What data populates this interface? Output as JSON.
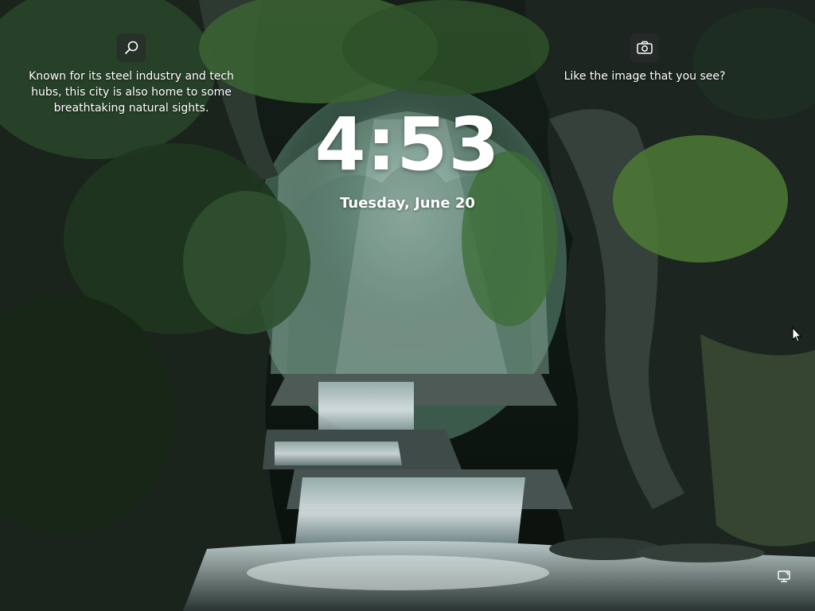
{
  "lockscreen": {
    "spotlight": {
      "info_icon": "search-icon",
      "info_text": "Known for its steel industry and tech hubs, this city is also home to some breathtaking natural sights.",
      "like_icon": "camera-icon",
      "like_text": "Like the image that you see?"
    },
    "clock": {
      "time": "4:53",
      "date": "Tuesday, June 20"
    },
    "status": {
      "network_icon": "network-icon"
    }
  },
  "colors": {
    "text": "#ffffff",
    "icon_button_bg": "#282c2a"
  }
}
